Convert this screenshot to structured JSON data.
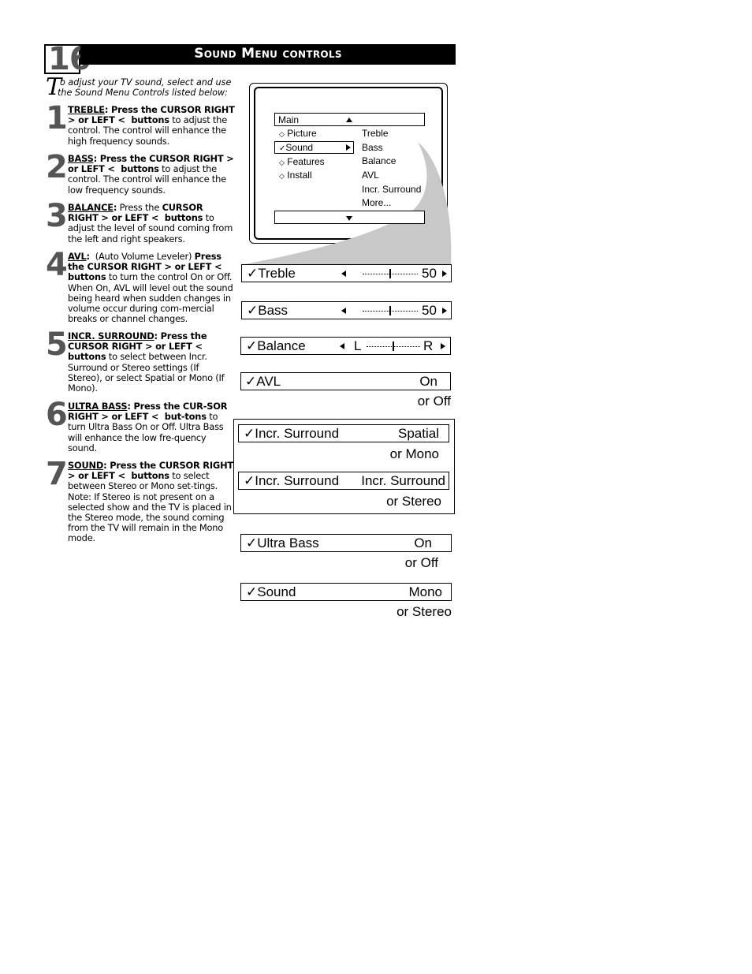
{
  "header": {
    "page_number": "16",
    "title": "Sound Menu controls"
  },
  "intro": {
    "dropcap": "T",
    "line1": "o adjust your TV sound, select and use",
    "line2": "the Sound Menu Controls listed below:"
  },
  "steps": [
    {
      "number": "1",
      "term": "TREBLE",
      "lines_html": "<u>TREBLE</u><b>: Press the CURSOR RIGHT &gt; or LEFT &lt;&nbsp; buttons</b> to adjust the control. The control will enhance the high frequency sounds."
    },
    {
      "number": "2",
      "term": "BASS",
      "lines_html": "<u>BASS</u><b>: Press the CURSOR RIGHT &gt; or LEFT &lt;&nbsp; buttons</b> to adjust the control. The control will enhance the low frequency sounds."
    },
    {
      "number": "3",
      "term": "BALANCE",
      "lines_html": "<u>BALANCE</u><b>:</b> Press the <b>CURSOR RIGHT &gt; or LEFT &lt;&nbsp; buttons</b> to adjust the level of sound coming from the left and right speakers."
    },
    {
      "number": "4",
      "term": "AVL",
      "lines_html": "<u>AVL</u><b>:</b>&nbsp; (Auto Volume Leveler) <b>Press the CURSOR RIGHT &gt; or LEFT &lt;&nbsp; buttons</b> to turn the control On or Off. When On, AVL will level out the sound being heard when sudden changes in volume occur during com-mercial breaks or channel changes."
    },
    {
      "number": "5",
      "term": "INCR. SURROUND",
      "lines_html": "<u>INCR. SURROUND</u><b>: Press the CURSOR RIGHT &gt; or LEFT &lt; buttons</b> to select between Incr. Surround or Stereo settings (If Stereo), or select Spatial or Mono (If Mono)."
    },
    {
      "number": "6",
      "term": "ULTRA BASS",
      "lines_html": "<u>ULTRA BASS</u><b>: Press the CUR-SOR RIGHT &gt; or LEFT &lt;&nbsp; but-tons</b> to turn Ultra Bass On or Off. Ultra Bass will enhance the low fre-quency sound."
    },
    {
      "number": "7",
      "term": "SOUND",
      "lines_html": "<u>SOUND</u><b>: Press the CURSOR RIGHT &gt; or LEFT &lt;&nbsp; buttons</b> to select between Stereo or Mono set-tings. Note: If Stereo is not present on a selected show and the TV is placed in the Stereo mode, the sound coming from the TV will remain in the Mono mode."
    }
  ],
  "tv_menu": {
    "header_label": "Main",
    "left_items": [
      {
        "label": "Picture",
        "marker": "◇",
        "selected": false
      },
      {
        "label": "Sound",
        "marker": "✓",
        "selected": true
      },
      {
        "label": "Features",
        "marker": "◇",
        "selected": false
      },
      {
        "label": "Install",
        "marker": "◇",
        "selected": false
      }
    ],
    "right_items": [
      "Treble",
      "Bass",
      "Balance",
      "AVL",
      "Incr. Surround",
      "More..."
    ]
  },
  "controls": {
    "treble": {
      "label": "✓Treble",
      "value": "50",
      "level": 0.5
    },
    "bass": {
      "label": "✓Bass",
      "value": "50",
      "level": 0.5
    },
    "balance": {
      "label": "✓Balance",
      "left": "L",
      "right": "R",
      "level": 0.5
    },
    "avl": {
      "label": "✓AVL",
      "value": "On",
      "alt": "or Off"
    },
    "incr_surround_mono": {
      "label": "✓Incr. Surround",
      "value": "Spatial",
      "alt": "or Mono"
    },
    "incr_surround_stereo": {
      "label": "✓Incr. Surround",
      "value": "Incr. Surround",
      "alt": "or Stereo"
    },
    "ultra_bass": {
      "label": "✓Ultra Bass",
      "value": "On",
      "alt": "or Off"
    },
    "sound": {
      "label": "✓Sound",
      "value": "Mono",
      "alt": "or Stereo"
    }
  },
  "colors": {
    "title_bar": "#000000",
    "swoosh": "#c8c8c8",
    "step_number": "#555555"
  }
}
